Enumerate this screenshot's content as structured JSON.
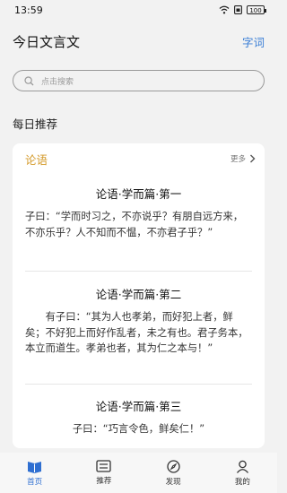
{
  "status": {
    "time": "13:59",
    "battery": "100"
  },
  "header": {
    "title": "今日文言文",
    "dict_link": "字词"
  },
  "search": {
    "placeholder": "点击搜索"
  },
  "section": {
    "title": "每日推荐"
  },
  "card": {
    "name": "论语",
    "more": "更多",
    "entries": [
      {
        "title": "论语·学而篇·第一",
        "text": "子曰：“学而时习之，不亦说乎？有朋自远方来，不亦乐乎？人不知而不愠，不亦君子乎？”"
      },
      {
        "title": "论语·学而篇·第二",
        "text": "有子曰：“其为人也孝弟，而好犯上者，鲜矣；不好犯上而好作乱者，未之有也。君子务本，本立而道生。孝弟也者，其为仁之本与！”"
      },
      {
        "title": "论语·学而篇·第三",
        "text": "子曰：“巧言令色，鲜矣仁！”"
      }
    ]
  },
  "tabs": [
    {
      "label": "首页",
      "icon": "book-icon",
      "active": true
    },
    {
      "label": "推荐",
      "icon": "list-card-icon",
      "active": false
    },
    {
      "label": "发现",
      "icon": "compass-icon",
      "active": false
    },
    {
      "label": "我的",
      "icon": "user-icon",
      "active": false
    }
  ],
  "colors": {
    "accent": "#2f6fd1",
    "link": "#3b7fd6",
    "card_name": "#d49a2a"
  }
}
